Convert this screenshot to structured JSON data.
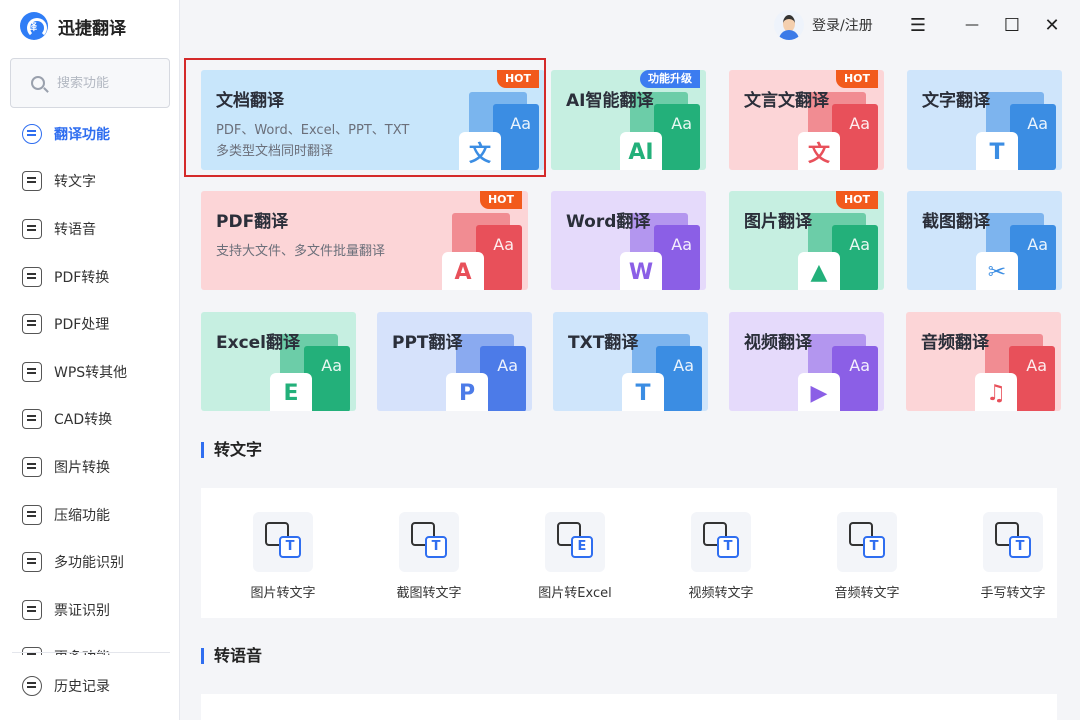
{
  "app": {
    "name": "迅捷翻译",
    "logo_char": "译"
  },
  "search": {
    "placeholder": "搜索功能"
  },
  "sidebar": {
    "items": [
      {
        "label": "翻译功能",
        "name": "sidebar-item-translate",
        "active": true
      },
      {
        "label": "转文字",
        "name": "sidebar-item-to-text"
      },
      {
        "label": "转语音",
        "name": "sidebar-item-to-speech"
      },
      {
        "label": "PDF转换",
        "name": "sidebar-item-pdf-convert"
      },
      {
        "label": "PDF处理",
        "name": "sidebar-item-pdf-process"
      },
      {
        "label": "WPS转其他",
        "name": "sidebar-item-wps-convert"
      },
      {
        "label": "CAD转换",
        "name": "sidebar-item-cad-convert"
      },
      {
        "label": "图片转换",
        "name": "sidebar-item-image-convert"
      },
      {
        "label": "压缩功能",
        "name": "sidebar-item-compress"
      },
      {
        "label": "多功能识别",
        "name": "sidebar-item-multi-recognize"
      },
      {
        "label": "票证识别",
        "name": "sidebar-item-ticket-recognize"
      },
      {
        "label": "更多功能",
        "name": "sidebar-item-more"
      }
    ],
    "history_label": "历史记录"
  },
  "topbar": {
    "login_label": "登录/注册",
    "menu_glyph": "☰",
    "minimize_glyph": "—",
    "maximize_glyph": "☐",
    "close_glyph": "✕"
  },
  "cards": [
    {
      "title": "文档翻译",
      "desc1": "PDF、Word、Excel、PPT、TXT",
      "desc2": "多类型文档同时翻译",
      "tag": "HOT",
      "icon": "文",
      "bg": "#c8e6fb",
      "accent": "#3b8de3"
    },
    {
      "title": "AI智能翻译",
      "tag": "功能升级",
      "icon": "AI",
      "bg": "#c6efe1",
      "accent": "#23b07a"
    },
    {
      "title": "文言文翻译",
      "tag": "HOT",
      "icon": "文",
      "bg": "#fcd5d7",
      "accent": "#e8505a"
    },
    {
      "title": "文字翻译",
      "icon": "T",
      "bg": "#cfe5fb",
      "accent": "#3b8de3"
    },
    {
      "title": "PDF翻译",
      "desc1": "支持大文件、多文件批量翻译",
      "tag": "HOT",
      "icon": "A",
      "bg": "#fcd5d7",
      "accent": "#e8505a"
    },
    {
      "title": "Word翻译",
      "icon": "W",
      "bg": "#e5dafb",
      "accent": "#8b5fe6"
    },
    {
      "title": "图片翻译",
      "tag": "HOT",
      "icon": "▲",
      "bg": "#c6efe1",
      "accent": "#23b07a"
    },
    {
      "title": "截图翻译",
      "icon": "✂",
      "bg": "#cfe5fb",
      "accent": "#3b8de3"
    },
    {
      "title": "Excel翻译",
      "icon": "E",
      "bg": "#c6efe1",
      "accent": "#23b07a"
    },
    {
      "title": "PPT翻译",
      "icon": "P",
      "bg": "#d6e2fb",
      "accent": "#4c7be8"
    },
    {
      "title": "TXT翻译",
      "icon": "T",
      "bg": "#cfe5fb",
      "accent": "#3b8de3"
    },
    {
      "title": "视频翻译",
      "icon": "▶",
      "bg": "#e5dafb",
      "accent": "#8b5fe6"
    },
    {
      "title": "音频翻译",
      "icon": "♫",
      "bg": "#fcd5d7",
      "accent": "#e8505a"
    }
  ],
  "sections": {
    "to_text": {
      "title": "转文字",
      "tools": [
        {
          "label": "图片转文字",
          "icon": "image-to-text-icon",
          "glyph": "T"
        },
        {
          "label": "截图转文字",
          "icon": "screenshot-to-text-icon",
          "glyph": "T"
        },
        {
          "label": "图片转Excel",
          "icon": "image-to-excel-icon",
          "glyph": "E"
        },
        {
          "label": "视频转文字",
          "icon": "video-to-text-icon",
          "glyph": "T"
        },
        {
          "label": "音频转文字",
          "icon": "audio-to-text-icon",
          "glyph": "T"
        },
        {
          "label": "手写转文字",
          "icon": "handwriting-to-text-icon",
          "glyph": "T"
        }
      ]
    },
    "to_speech": {
      "title": "转语音"
    }
  }
}
